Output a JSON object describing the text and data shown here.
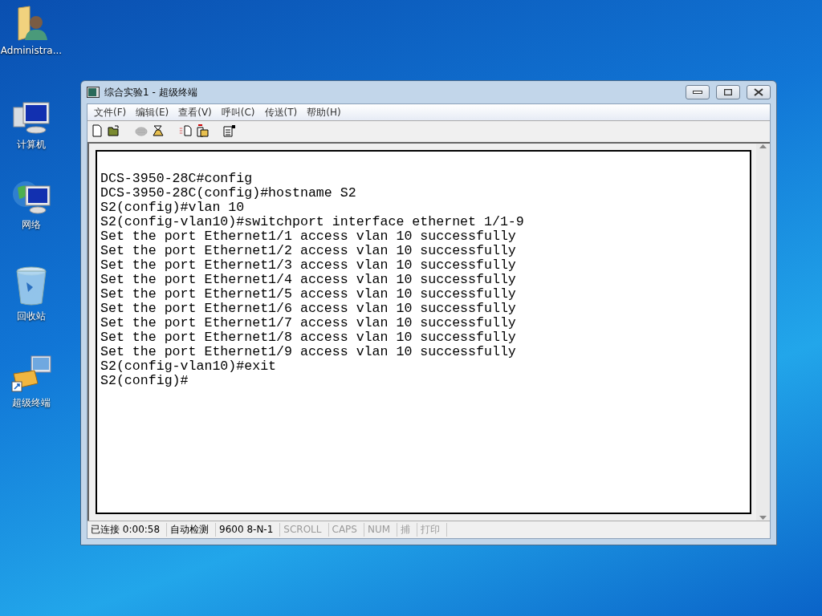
{
  "desktop_icons": [
    {
      "kind": "user-folder",
      "label": "Administra..."
    },
    {
      "kind": "computer",
      "label": "计算机"
    },
    {
      "kind": "network",
      "label": "网络"
    },
    {
      "kind": "recycle-bin",
      "label": "回收站"
    },
    {
      "kind": "terminal-shortcut",
      "label": "超级终端"
    }
  ],
  "window": {
    "title": "综合实验1 - 超级终端"
  },
  "menu": [
    "文件(F)",
    "编辑(E)",
    "查看(V)",
    "呼叫(C)",
    "传送(T)",
    "帮助(H)"
  ],
  "toolbar": [
    {
      "kind": "new",
      "disabled": false
    },
    {
      "kind": "open",
      "disabled": false
    },
    {
      "kind": "disconnect",
      "disabled": true
    },
    {
      "kind": "dial",
      "disabled": false
    },
    {
      "kind": "send",
      "disabled": false
    },
    {
      "kind": "receive",
      "disabled": false
    },
    {
      "kind": "properties",
      "disabled": false
    }
  ],
  "terminal_lines": [
    "DCS-3950-28C#config",
    "DCS-3950-28C(config)#hostname S2",
    "S2(config)#vlan 10",
    "S2(config-vlan10)#switchport interface ethernet 1/1-9",
    "Set the port Ethernet1/1 access vlan 10 successfully",
    "Set the port Ethernet1/2 access vlan 10 successfully",
    "Set the port Ethernet1/3 access vlan 10 successfully",
    "Set the port Ethernet1/4 access vlan 10 successfully",
    "Set the port Ethernet1/5 access vlan 10 successfully",
    "Set the port Ethernet1/6 access vlan 10 successfully",
    "Set the port Ethernet1/7 access vlan 10 successfully",
    "Set the port Ethernet1/8 access vlan 10 successfully",
    "Set the port Ethernet1/9 access vlan 10 successfully",
    "S2(config-vlan10)#exit",
    "S2(config)#"
  ],
  "status_bar": [
    {
      "text": "已连接 0:00:58",
      "active": true
    },
    {
      "text": "自动检测",
      "active": true
    },
    {
      "text": "9600 8-N-1",
      "active": true
    },
    {
      "text": "SCROLL",
      "active": false
    },
    {
      "text": "CAPS",
      "active": false
    },
    {
      "text": "NUM",
      "active": false
    },
    {
      "text": "捕",
      "active": false
    },
    {
      "text": "打印",
      "active": false
    }
  ]
}
